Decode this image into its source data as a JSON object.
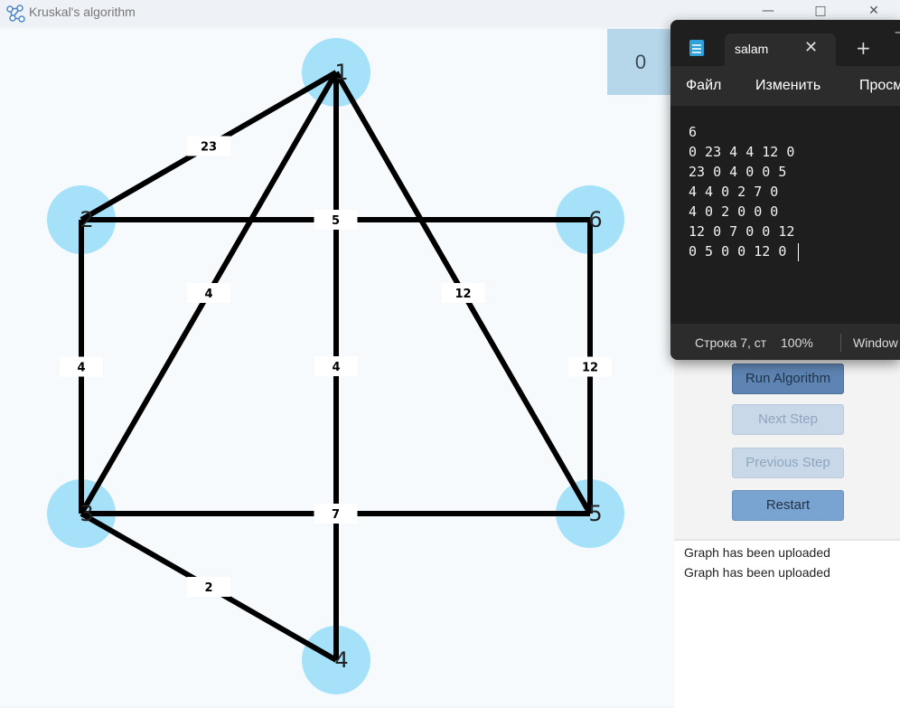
{
  "window": {
    "title": "Kruskal's algorithm",
    "minimize_icon": "minimize-icon",
    "maximize_icon": "maximize-icon",
    "close_icon": "close-icon"
  },
  "graph": {
    "node_color": "#a5e1f9",
    "edge_color": "#000000",
    "nodes": [
      {
        "id": "1",
        "label": "1"
      },
      {
        "id": "2",
        "label": "2"
      },
      {
        "id": "3",
        "label": "3"
      },
      {
        "id": "4",
        "label": "4"
      },
      {
        "id": "5",
        "label": "5"
      },
      {
        "id": "6",
        "label": "6"
      }
    ],
    "edges": [
      {
        "from": "1",
        "to": "2",
        "weight": "23"
      },
      {
        "from": "1",
        "to": "3",
        "weight": "4"
      },
      {
        "from": "1",
        "to": "4",
        "weight": "4"
      },
      {
        "from": "1",
        "to": "5",
        "weight": "12"
      },
      {
        "from": "2",
        "to": "6",
        "weight": "5"
      },
      {
        "from": "2",
        "to": "3",
        "weight": "4"
      },
      {
        "from": "3",
        "to": "5",
        "weight": "7"
      },
      {
        "from": "3",
        "to": "4",
        "weight": "2"
      },
      {
        "from": "6",
        "to": "5",
        "weight": "12"
      }
    ]
  },
  "counter": {
    "value": "0"
  },
  "controls": {
    "run_label": "Run Algorithm",
    "next_label": "Next Step",
    "prev_label": "Previous Step",
    "restart_label": "Restart"
  },
  "log": {
    "lines": [
      "Graph has been uploaded",
      "Graph has been uploaded"
    ]
  },
  "notepad": {
    "tab_title": "salam",
    "menu": [
      "Файл",
      "Изменить",
      "Просм"
    ],
    "lines": [
      "6",
      "0 23 4 4 12 0",
      "23 0 4 0 0 5",
      "4 4 0 2 7 0",
      "4 0 2 0 0 0",
      "12 0 7 0 0 12",
      "0 5 0 0 12 0"
    ],
    "status_position": "Строка 7, ст",
    "status_zoom": "100%",
    "status_encoding": "Window"
  }
}
